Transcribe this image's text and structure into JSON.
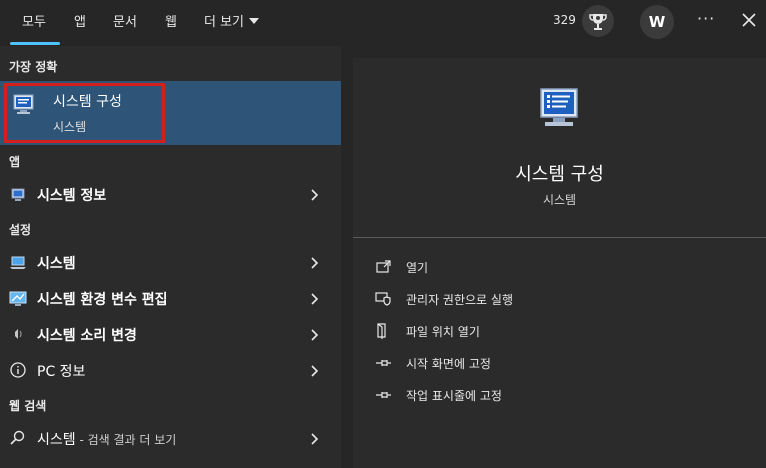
{
  "top_tabs": [
    "모두",
    "앱",
    "문서",
    "웹",
    "더 보기"
  ],
  "points": "329",
  "avatar_initial": "W",
  "more_options": "···",
  "left": {
    "best_match_label": "가장 정확",
    "best_match": {
      "title": "시스템 구성",
      "subtitle": "시스템"
    },
    "apps_label": "앱",
    "apps": [
      {
        "label": "시스템 정보"
      }
    ],
    "settings_label": "설정",
    "settings": [
      {
        "label": "시스템"
      },
      {
        "label": "시스템 환경 변수 편집"
      },
      {
        "label": "시스템 소리 변경"
      },
      {
        "label": "PC 정보"
      }
    ],
    "web_label": "웹 검색",
    "web": {
      "label": "시스템",
      "suffix": " - 검색 결과 더 보기"
    }
  },
  "right": {
    "title": "시스템 구성",
    "subtitle": "시스템",
    "actions": [
      {
        "label": "열기",
        "icon": "open-icon"
      },
      {
        "label": "관리자 권한으로 실행",
        "icon": "admin-shield-icon"
      },
      {
        "label": "파일 위치 열기",
        "icon": "file-location-icon"
      },
      {
        "label": "시작 화면에 고정",
        "icon": "pin-icon"
      },
      {
        "label": "작업 표시줄에 고정",
        "icon": "pin-icon"
      }
    ]
  },
  "colors": {
    "accent": "#4cc2ff",
    "selected_bg": "#2e5578",
    "highlight_outline": "#d41f1f"
  }
}
